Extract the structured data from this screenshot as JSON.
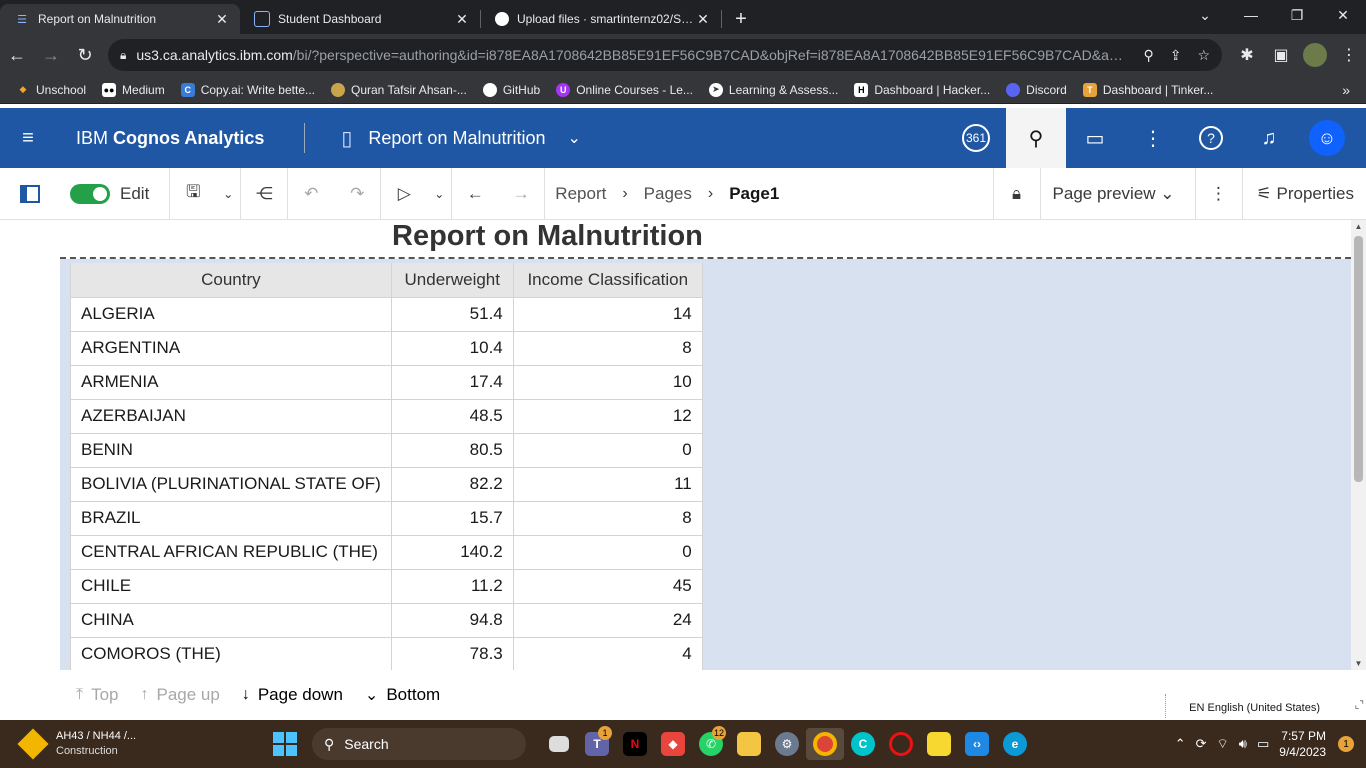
{
  "browser": {
    "tabs": [
      {
        "title": "Report on Malnutrition",
        "active": true,
        "icon": "cognos-icon"
      },
      {
        "title": "Student Dashboard",
        "active": false,
        "icon": "dashboard-icon"
      },
      {
        "title": "Upload files · smartinternz02/SBS",
        "active": false,
        "icon": "github-icon"
      }
    ],
    "url_domain": "us3.ca.analytics.ibm.com",
    "url_rest": "/bi/?perspective=authoring&id=i878EA8A1708642BB85E91EF56C9B7CAD&objRef=i878EA8A1708642BB85E91EF56C9B7CAD&action...",
    "bookmarks": [
      {
        "label": "Unschool",
        "color": "#f5a623"
      },
      {
        "label": "Medium",
        "color": "#ffffff"
      },
      {
        "label": "Copy.ai: Write bette...",
        "color": "#3a7bd5"
      },
      {
        "label": "Quran Tafsir Ahsan-...",
        "color": "#c8a44a"
      },
      {
        "label": "GitHub",
        "color": "#ffffff"
      },
      {
        "label": "Online Courses - Le...",
        "color": "#a435f0"
      },
      {
        "label": "Learning & Assess...",
        "color": "#ffffff"
      },
      {
        "label": "Dashboard | Hacker...",
        "color": "#ffffff"
      },
      {
        "label": "Discord",
        "color": "#5865f2"
      },
      {
        "label": "Dashboard | Tinker...",
        "color": "#e8a23a"
      }
    ]
  },
  "cognos": {
    "brand_prefix": "IBM",
    "brand_name": "Cognos Analytics",
    "report_name": "Report on Malnutrition",
    "badge": "361",
    "toolbar": {
      "edit_label": "Edit",
      "breadcrumb": [
        "Report",
        "Pages",
        "Page1"
      ],
      "page_preview": "Page preview",
      "properties": "Properties"
    },
    "report_title": "Report on Malnutrition",
    "table": {
      "headers": [
        "Country",
        "Underweight",
        "Income Classification"
      ],
      "rows": [
        [
          "ALGERIA",
          "51.4",
          "14"
        ],
        [
          "ARGENTINA",
          "10.4",
          "8"
        ],
        [
          "ARMENIA",
          "17.4",
          "10"
        ],
        [
          "AZERBAIJAN",
          "48.5",
          "12"
        ],
        [
          "BENIN",
          "80.5",
          "0"
        ],
        [
          "BOLIVIA (PLURINATIONAL STATE OF)",
          "82.2",
          "11"
        ],
        [
          "BRAZIL",
          "15.7",
          "8"
        ],
        [
          "CENTRAL AFRICAN REPUBLIC (THE)",
          "140.2",
          "0"
        ],
        [
          "CHILE",
          "11.2",
          "45"
        ],
        [
          "CHINA",
          "94.8",
          "24"
        ],
        [
          "COMOROS (THE)",
          "78.3",
          "4"
        ]
      ]
    },
    "pager": {
      "top": "Top",
      "page_up": "Page up",
      "page_down": "Page down",
      "bottom": "Bottom"
    },
    "language": "EN English (United States)"
  },
  "taskbar": {
    "weather_title": "AH43 / NH44 /...",
    "weather_sub": "Construction",
    "search": "Search",
    "time": "7:57 PM",
    "date": "9/4/2023",
    "notification_count": "1",
    "app_badges": {
      "teams": "1",
      "whatsapp": "12"
    }
  }
}
